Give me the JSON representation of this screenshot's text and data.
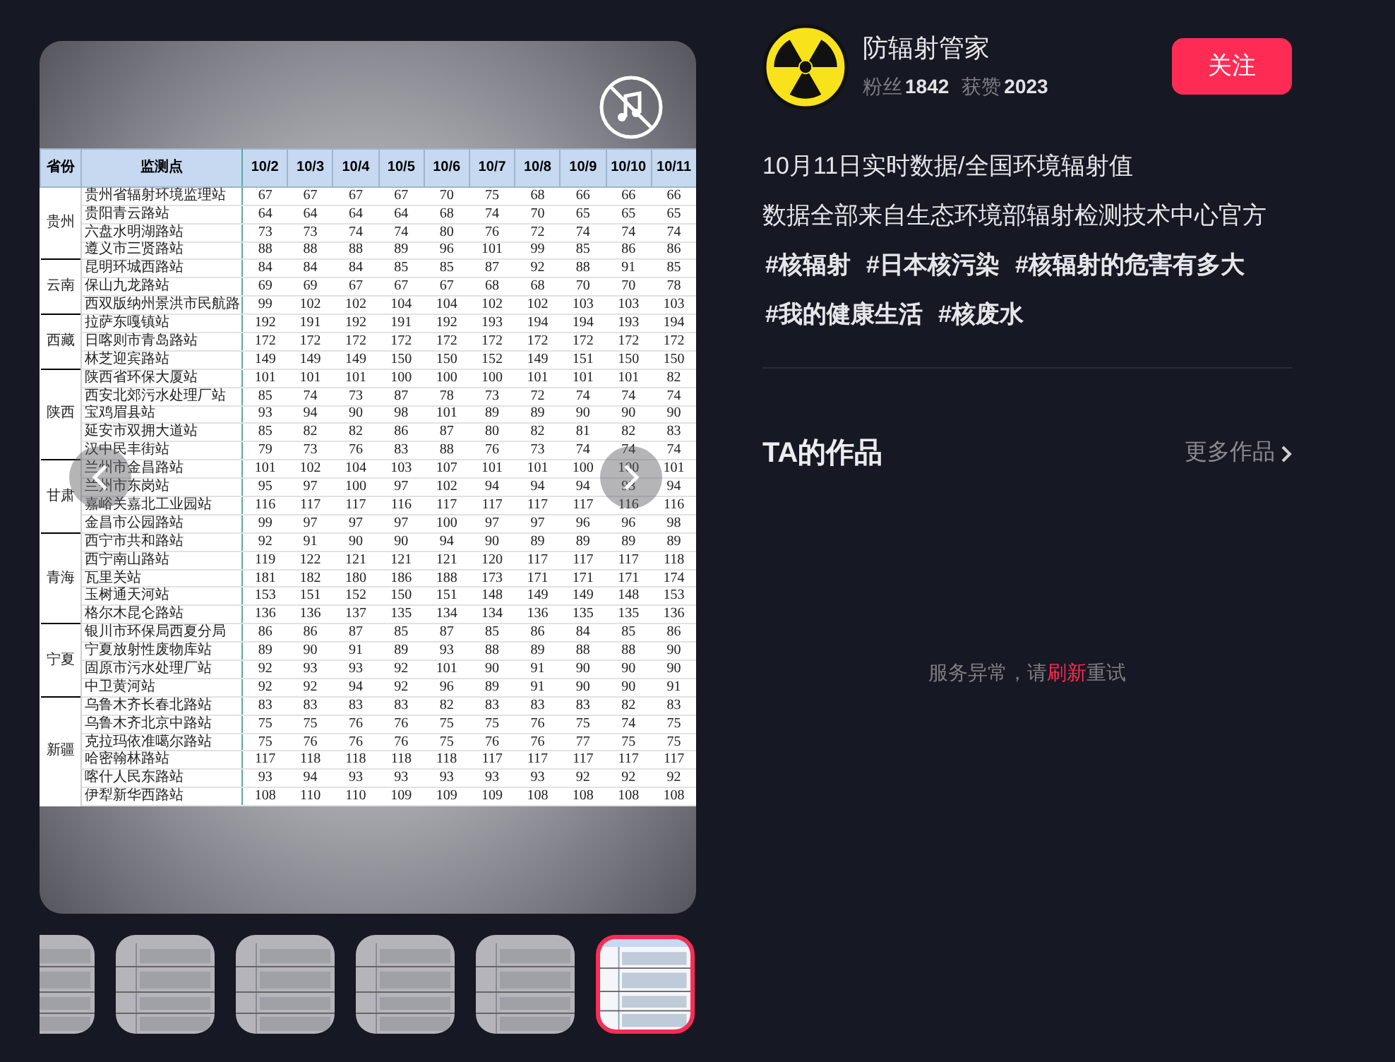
{
  "post": {
    "sound_muted": true,
    "table": {
      "columns": [
        "省份",
        "监测点",
        "10/2",
        "10/3",
        "10/4",
        "10/5",
        "10/6",
        "10/7",
        "10/8",
        "10/9",
        "10/10",
        "10/11"
      ],
      "groups": [
        {
          "province": "贵州",
          "rows": [
            {
              "station": "贵州省辐射环境监理站",
              "values": [
                "67",
                "67",
                "67",
                "67",
                "70",
                "75",
                "68",
                "66",
                "66",
                "66"
              ]
            },
            {
              "station": "贵阳青云路站",
              "values": [
                "64",
                "64",
                "64",
                "64",
                "68",
                "74",
                "70",
                "65",
                "65",
                "65"
              ]
            },
            {
              "station": "六盘水明湖路站",
              "values": [
                "73",
                "73",
                "74",
                "74",
                "80",
                "76",
                "72",
                "74",
                "74",
                "74"
              ]
            },
            {
              "station": "遵义市三贤路站",
              "values": [
                "88",
                "88",
                "88",
                "89",
                "96",
                "101",
                "99",
                "85",
                "86",
                "86"
              ]
            }
          ]
        },
        {
          "province": "云南",
          "rows": [
            {
              "station": "昆明环城西路站",
              "values": [
                "84",
                "84",
                "84",
                "85",
                "85",
                "87",
                "92",
                "88",
                "91",
                "85"
              ]
            },
            {
              "station": "保山九龙路站",
              "values": [
                "69",
                "69",
                "67",
                "67",
                "67",
                "68",
                "68",
                "70",
                "70",
                "78"
              ]
            },
            {
              "station": "西双版纳州景洪市民航路",
              "values": [
                "99",
                "102",
                "102",
                "104",
                "104",
                "102",
                "102",
                "103",
                "103",
                "103"
              ]
            }
          ]
        },
        {
          "province": "西藏",
          "rows": [
            {
              "station": "拉萨东嘎镇站",
              "values": [
                "192",
                "191",
                "192",
                "191",
                "192",
                "193",
                "194",
                "194",
                "193",
                "194"
              ]
            },
            {
              "station": "日喀则市青岛路站",
              "values": [
                "172",
                "172",
                "172",
                "172",
                "172",
                "172",
                "172",
                "172",
                "172",
                "172"
              ]
            },
            {
              "station": "林芝迎宾路站",
              "values": [
                "149",
                "149",
                "149",
                "150",
                "150",
                "152",
                "149",
                "151",
                "150",
                "150"
              ]
            }
          ]
        },
        {
          "province": "陕西",
          "rows": [
            {
              "station": "陕西省环保大厦站",
              "values": [
                "101",
                "101",
                "101",
                "100",
                "100",
                "100",
                "101",
                "101",
                "101",
                "82"
              ]
            },
            {
              "station": "西安北郊污水处理厂站",
              "values": [
                "85",
                "74",
                "73",
                "87",
                "78",
                "73",
                "72",
                "74",
                "74",
                "74"
              ]
            },
            {
              "station": "宝鸡眉县站",
              "values": [
                "93",
                "94",
                "90",
                "98",
                "101",
                "89",
                "89",
                "90",
                "90",
                "90"
              ]
            },
            {
              "station": "延安市双拥大道站",
              "values": [
                "85",
                "82",
                "82",
                "86",
                "87",
                "80",
                "82",
                "81",
                "82",
                "83"
              ]
            },
            {
              "station": "汉中民丰街站",
              "values": [
                "79",
                "73",
                "76",
                "83",
                "88",
                "76",
                "73",
                "74",
                "74",
                "74"
              ]
            }
          ]
        },
        {
          "province": "甘肃",
          "rows": [
            {
              "station": "兰州市金昌路站",
              "values": [
                "101",
                "102",
                "104",
                "103",
                "107",
                "101",
                "101",
                "100",
                "100",
                "101"
              ]
            },
            {
              "station": "兰州市东岗站",
              "values": [
                "95",
                "97",
                "100",
                "97",
                "102",
                "94",
                "94",
                "94",
                "93",
                "94"
              ]
            },
            {
              "station": "嘉峪关嘉北工业园站",
              "values": [
                "116",
                "117",
                "117",
                "116",
                "117",
                "117",
                "117",
                "117",
                "116",
                "116"
              ]
            },
            {
              "station": "金昌市公园路站",
              "values": [
                "99",
                "97",
                "97",
                "97",
                "100",
                "97",
                "97",
                "96",
                "96",
                "98"
              ]
            }
          ]
        },
        {
          "province": "青海",
          "rows": [
            {
              "station": "西宁市共和路站",
              "values": [
                "92",
                "91",
                "90",
                "90",
                "94",
                "90",
                "89",
                "89",
                "89",
                "89"
              ]
            },
            {
              "station": "西宁南山路站",
              "values": [
                "119",
                "122",
                "121",
                "121",
                "121",
                "120",
                "117",
                "117",
                "117",
                "118"
              ]
            },
            {
              "station": "瓦里关站",
              "values": [
                "181",
                "182",
                "180",
                "186",
                "188",
                "173",
                "171",
                "171",
                "171",
                "174"
              ]
            },
            {
              "station": "玉树通天河站",
              "values": [
                "153",
                "151",
                "152",
                "150",
                "151",
                "148",
                "149",
                "149",
                "148",
                "153"
              ]
            },
            {
              "station": "格尔木昆仑路站",
              "values": [
                "136",
                "136",
                "137",
                "135",
                "134",
                "134",
                "136",
                "135",
                "135",
                "136"
              ]
            }
          ]
        },
        {
          "province": "宁夏",
          "rows": [
            {
              "station": "银川市环保局西夏分局",
              "values": [
                "86",
                "86",
                "87",
                "85",
                "87",
                "85",
                "86",
                "84",
                "85",
                "86"
              ]
            },
            {
              "station": "宁夏放射性废物库站",
              "values": [
                "89",
                "90",
                "91",
                "89",
                "93",
                "88",
                "89",
                "88",
                "88",
                "90"
              ]
            },
            {
              "station": "固原市污水处理厂站",
              "values": [
                "92",
                "93",
                "93",
                "92",
                "101",
                "90",
                "91",
                "90",
                "90",
                "90"
              ]
            },
            {
              "station": "中卫黄河站",
              "values": [
                "92",
                "92",
                "94",
                "92",
                "96",
                "89",
                "91",
                "90",
                "90",
                "91"
              ]
            }
          ]
        },
        {
          "province": "新疆",
          "rows": [
            {
              "station": "乌鲁木齐长春北路站",
              "values": [
                "83",
                "83",
                "83",
                "83",
                "82",
                "83",
                "83",
                "83",
                "82",
                "83"
              ]
            },
            {
              "station": "乌鲁木齐北京中路站",
              "values": [
                "75",
                "75",
                "76",
                "76",
                "75",
                "75",
                "76",
                "75",
                "74",
                "75"
              ]
            },
            {
              "station": "克拉玛依准噶尔路站",
              "values": [
                "75",
                "76",
                "76",
                "76",
                "75",
                "76",
                "76",
                "77",
                "75",
                "75"
              ]
            },
            {
              "station": "哈密翰林路站",
              "values": [
                "117",
                "118",
                "118",
                "118",
                "118",
                "117",
                "117",
                "117",
                "117",
                "117"
              ]
            },
            {
              "station": "喀什人民东路站",
              "values": [
                "93",
                "94",
                "93",
                "93",
                "93",
                "93",
                "93",
                "92",
                "92",
                "92"
              ]
            },
            {
              "station": "伊犁新华西路站",
              "values": [
                "108",
                "110",
                "110",
                "109",
                "109",
                "109",
                "108",
                "108",
                "108",
                "108"
              ]
            }
          ]
        }
      ]
    }
  },
  "thumbnails": [
    {
      "kind": "picture",
      "selected": false
    },
    {
      "kind": "picture",
      "selected": false
    },
    {
      "kind": "picture",
      "selected": false
    },
    {
      "kind": "picture",
      "selected": false
    },
    {
      "kind": "picture",
      "selected": false
    },
    {
      "kind": "picture",
      "selected": true
    }
  ],
  "author": {
    "name": "防辐射管家",
    "followers_label": "粉丝",
    "followers": "1842",
    "likes_label": "获赞",
    "likes": "2023",
    "follow_button": "关注"
  },
  "description": {
    "lines": [
      "10月11日实时数据/全国环境辐射值",
      "数据全部来自生态环境部辐射检测技术中心官方"
    ],
    "tags": [
      "#核辐射",
      "#日本核污染",
      "#核辐射的危害有多大",
      "#我的健康生活",
      "#核废水"
    ]
  },
  "works": {
    "title": "TA的作品",
    "more": "更多作品",
    "error": {
      "before": "服务异常，请",
      "link": "刷新",
      "after": "重试"
    }
  }
}
